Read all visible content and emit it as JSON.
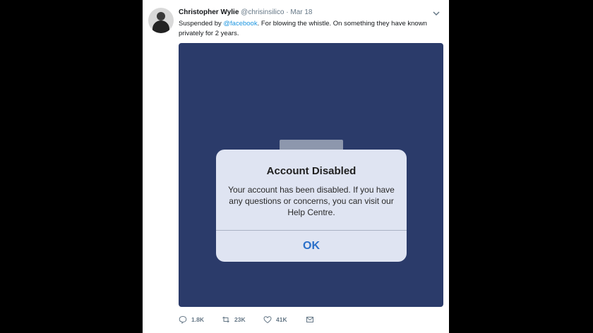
{
  "tweet": {
    "author_name": "Christopher Wylie",
    "handle": "@chrisinsilico",
    "separator": "·",
    "date": "Mar 18",
    "text_before": "Suspended by ",
    "mention": "@facebook",
    "text_after": ". For blowing the whistle. On something they have known privately for 2 years."
  },
  "dialog": {
    "title": "Account Disabled",
    "message": "Your account has been disabled. If you have any questions or concerns, you can visit our Help Centre.",
    "ok_label": "OK"
  },
  "actions": {
    "replies": "1.8K",
    "retweets": "23K",
    "likes": "41K"
  },
  "colors": {
    "media_background": "#2b3b6a",
    "dialog_background": "#dfe4f2",
    "ok_text": "#2a6fc9",
    "mention": "#1b95e0"
  },
  "icons": [
    "avatar",
    "chevron-down-icon",
    "reply-icon",
    "retweet-icon",
    "like-icon",
    "message-icon"
  ]
}
